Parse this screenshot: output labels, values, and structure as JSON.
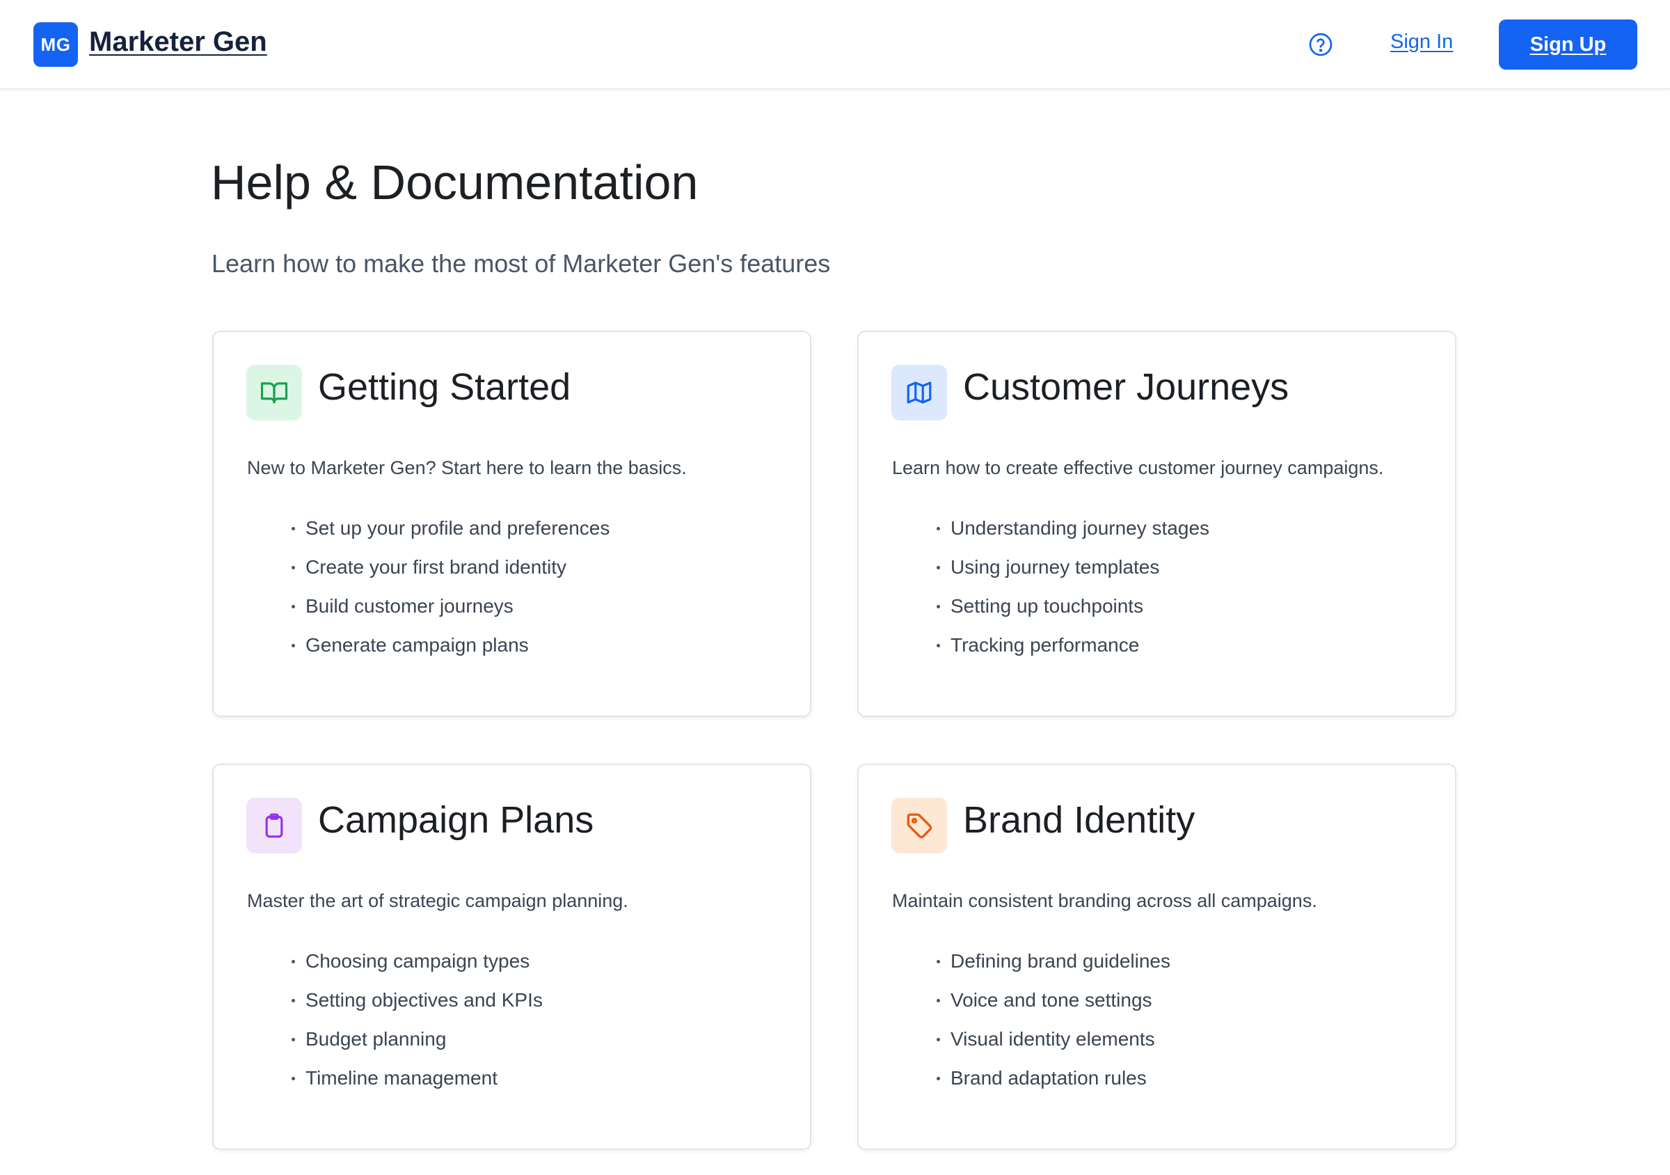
{
  "header": {
    "logo_initials": "MG",
    "app_name": "Marketer Gen",
    "help_icon": "question-circle-icon",
    "sign_in_label": "Sign In",
    "sign_up_label": "Sign Up"
  },
  "page": {
    "title": "Help & Documentation",
    "subtitle": "Learn how to make the most of Marketer Gen's features"
  },
  "colors": {
    "accent": "#1463f3",
    "green": "#16a34a",
    "blue": "#1463f3",
    "purple": "#9333ea",
    "orange": "#ea580c"
  },
  "sections": [
    {
      "title": "Getting Started",
      "icon": "book-open-icon",
      "description": "New to Marketer Gen? Start here to learn the basics.",
      "items": [
        "Set up your profile and preferences",
        "Create your first brand identity",
        "Build customer journeys",
        "Generate campaign plans"
      ]
    },
    {
      "title": "Customer Journeys",
      "icon": "map-icon",
      "description": "Learn how to create effective customer journey campaigns.",
      "items": [
        "Understanding journey stages",
        "Using journey templates",
        "Setting up touchpoints",
        "Tracking performance"
      ]
    },
    {
      "title": "Campaign Plans",
      "icon": "clipboard-icon",
      "description": "Master the art of strategic campaign planning.",
      "items": [
        "Choosing campaign types",
        "Setting objectives and KPIs",
        "Budget planning",
        "Timeline management"
      ]
    },
    {
      "title": "Brand Identity",
      "icon": "tag-icon",
      "description": "Maintain consistent branding across all campaigns.",
      "items": [
        "Defining brand guidelines",
        "Voice and tone settings",
        "Visual identity elements",
        "Brand adaptation rules"
      ]
    }
  ]
}
